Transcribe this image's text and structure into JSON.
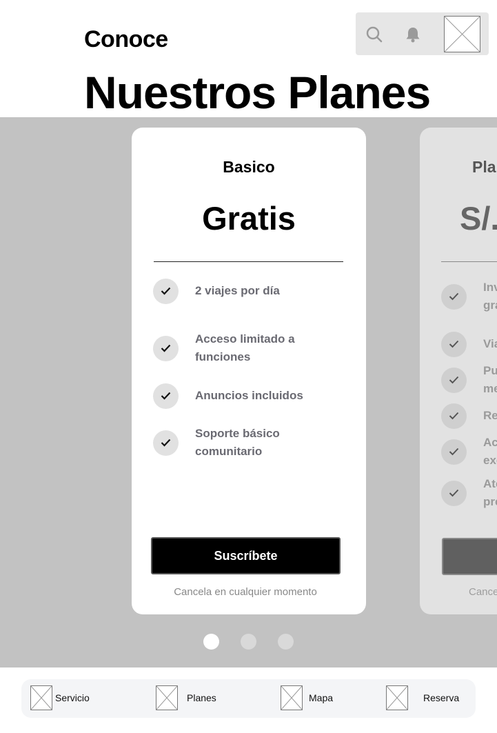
{
  "header": {
    "eyebrow": "Conoce",
    "title": "Nuestros Planes",
    "toolbar": {
      "search_icon": "search-icon",
      "notifications_icon": "bell-icon",
      "avatar": "image-placeholder"
    }
  },
  "plans": [
    {
      "name": "Basico",
      "price": "Gratis",
      "features": [
        "2 viajes por día",
        "Acceso limitado a funciones",
        "Anuncios incluidos",
        "Soporte básico comunitario"
      ],
      "cta": "Suscríbete",
      "note": "Cancela en cualquier momento"
    },
    {
      "name": "Pla",
      "price": "S/.",
      "features": [
        "Inv\ngra",
        "Via",
        "Pu\nme",
        "Re",
        "Ac\nexe",
        "Ate\npre"
      ],
      "cta": "",
      "note": "Cance"
    }
  ],
  "pagination": {
    "count": 3,
    "active": 1
  },
  "bottom_nav": {
    "items": [
      {
        "label": "Servicio",
        "icon": "image-placeholder"
      },
      {
        "label": "Planes",
        "icon": "image-placeholder"
      },
      {
        "label": "Mapa",
        "icon": "image-placeholder"
      },
      {
        "label": "Reserva",
        "icon": "image-placeholder"
      }
    ]
  },
  "colors": {
    "carousel_bg": "#c2c2c2",
    "cta_bg": "#000000",
    "feature_text": "#6a6a72"
  }
}
